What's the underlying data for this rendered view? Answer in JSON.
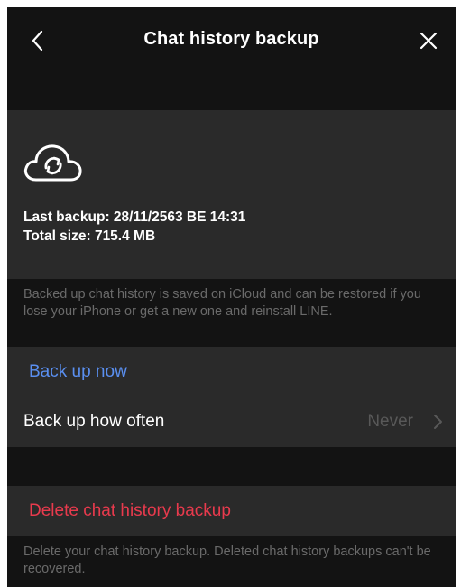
{
  "header": {
    "title": "Chat history backup",
    "back_icon": "chevron-left-icon",
    "close_icon": "close-icon"
  },
  "backup_card": {
    "icon": "cloud-sync-icon",
    "last_backup": "Last backup: 28/11/2563 BE 14:31",
    "total_size": "Total size: 715.4 MB"
  },
  "info_note": "Backed up chat history is saved on iCloud and can be restored if you lose your iPhone or get a new one and reinstall LINE.",
  "settings": {
    "back_up_now_label": "Back up now",
    "back_up_how_often_label": "Back up how often",
    "back_up_how_often_value": "Never",
    "chevron_icon": "chevron-right-icon"
  },
  "delete": {
    "label": "Delete chat history backup",
    "note": "Delete your chat history backup. Deleted chat history backups can't be recovered."
  },
  "colors": {
    "background": "#131313",
    "card": "#2a2a2a",
    "link_blue": "#5a8ff0",
    "destructive_red": "#e83a4d",
    "secondary_text": "#6a6a6a"
  }
}
